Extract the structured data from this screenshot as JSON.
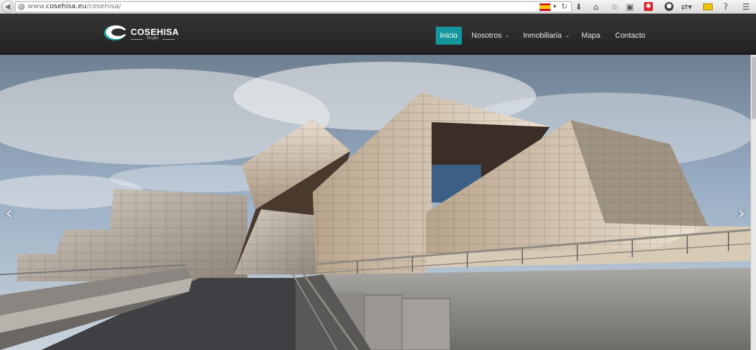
{
  "browser": {
    "url_prefix": "www.",
    "url_domain": "cosehisa.eu",
    "url_path": "/cosehisa/"
  },
  "site": {
    "logo_name": "COSEHISA",
    "logo_sub": "Grupo"
  },
  "nav": {
    "items": [
      {
        "label": "Inicio",
        "active": true
      },
      {
        "label": "Nosotros",
        "dropdown": true
      },
      {
        "label": "Inmobiliaria",
        "dropdown": true
      },
      {
        "label": "Mapa"
      },
      {
        "label": "Contacto"
      }
    ]
  },
  "hero": {
    "prev_glyph": "‹",
    "next_glyph": "›"
  },
  "colors": {
    "accent": "#13979d",
    "navbar": "#2b2b2b"
  },
  "icons": [
    "back-icon",
    "globe-icon",
    "flag-es-icon",
    "dropdown-icon",
    "reload-icon",
    "download-icon",
    "home-icon",
    "bookmark-star-icon",
    "clipboard-icon",
    "addon-red-icon",
    "addon-dark-icon",
    "addon-arrows-icon",
    "addon-yellow-icon",
    "addon-question-icon",
    "menu-icon",
    "caret-down-icon",
    "prev-arrow-icon",
    "next-arrow-icon"
  ]
}
